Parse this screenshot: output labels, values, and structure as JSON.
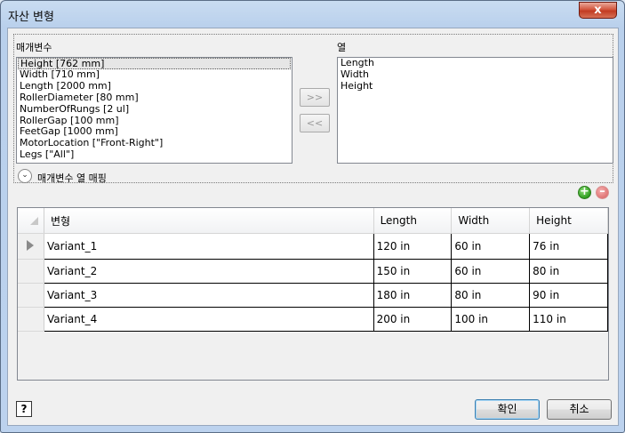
{
  "window": {
    "title": "자산 변형",
    "close_label": "x"
  },
  "params": {
    "label": "매개변수",
    "items": [
      "Height [762 mm]",
      "Width [710 mm]",
      "Length [2000 mm]",
      "RollerDiameter [80 mm]",
      "NumberOfRungs [2 ul]",
      "RollerGap [100 mm]",
      "FeetGap [1000 mm]",
      "MotorLocation [\"Front-Right\"]",
      "Legs [\"All\"]"
    ],
    "selected_index": 0
  },
  "columns": {
    "label": "열",
    "items": [
      "Length",
      "Width",
      "Height"
    ]
  },
  "move_buttons": {
    "add": ">>",
    "remove": "<<"
  },
  "mapping": {
    "label": "매개변수 열 매핑"
  },
  "grid": {
    "headers": [
      "변형",
      "Length",
      "Width",
      "Height"
    ],
    "rows": [
      [
        "Variant_1",
        "120 in",
        "60 in",
        "76 in"
      ],
      [
        "Variant_2",
        "150 in",
        "60 in",
        "80 in"
      ],
      [
        "Variant_3",
        "180 in",
        "80 in",
        "90 in"
      ],
      [
        "Variant_4",
        "200 in",
        "100 in",
        "110 in"
      ]
    ]
  },
  "footer": {
    "help_label": "?",
    "ok_label": "확인",
    "cancel_label": "취소"
  }
}
